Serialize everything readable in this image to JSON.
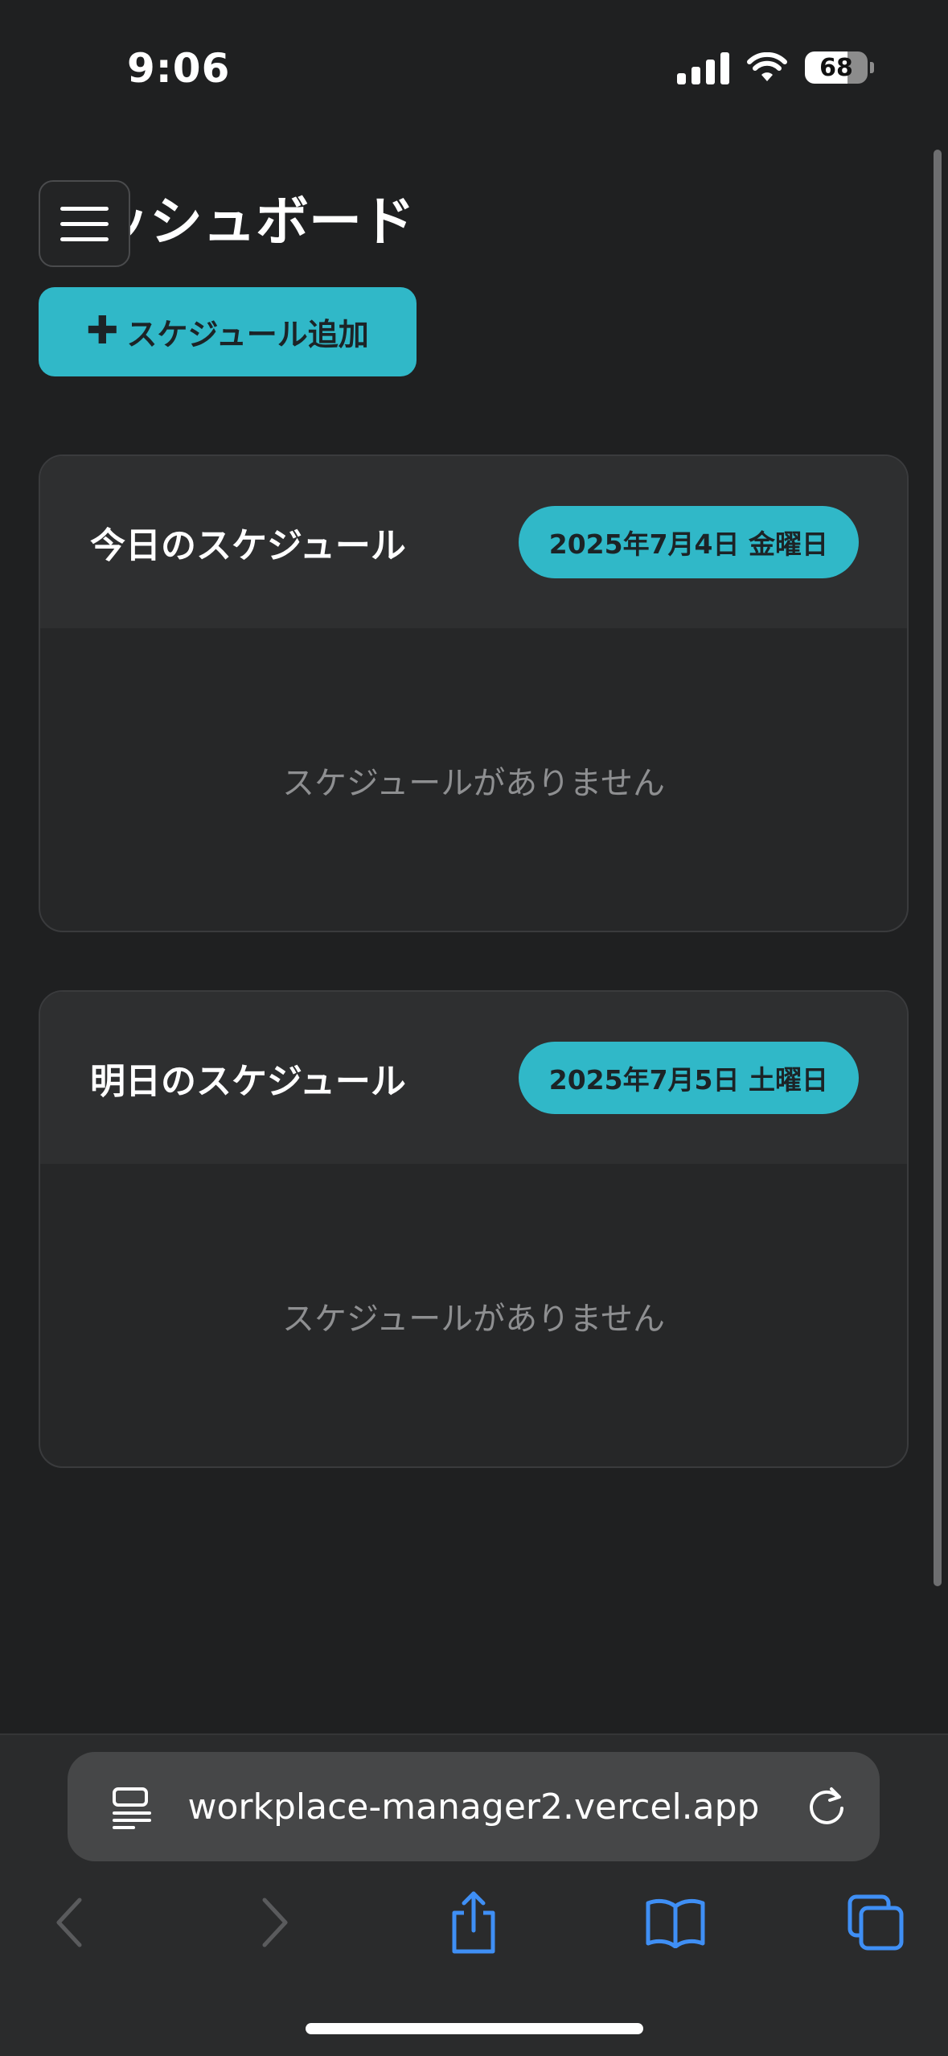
{
  "status_bar": {
    "time": "9:06",
    "battery": "68"
  },
  "page": {
    "title": "ダッシュボード",
    "title_visible": "ッシュボード"
  },
  "actions": {
    "add_schedule_label": "スケジュール追加"
  },
  "cards": [
    {
      "title": "今日のスケジュール",
      "date": "2025年7月4日 金曜日",
      "empty": "スケジュールがありません"
    },
    {
      "title": "明日のスケジュール",
      "date": "2025年7月5日 土曜日",
      "empty": "スケジュールがありません"
    }
  ],
  "browser": {
    "url": "workplace-manager2.vercel.app"
  },
  "colors": {
    "accent": "#30b8c8",
    "background": "#1f2021",
    "link_blue": "#3f8ff5"
  }
}
